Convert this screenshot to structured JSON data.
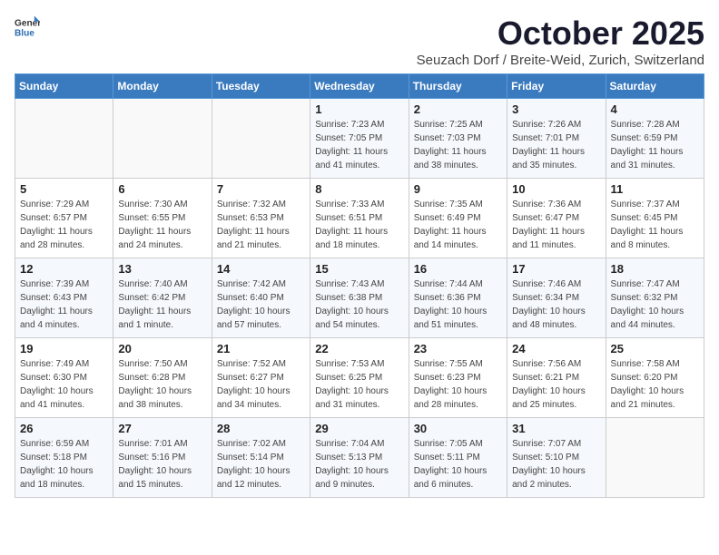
{
  "logo": {
    "text_general": "General",
    "text_blue": "Blue"
  },
  "title": "October 2025",
  "location": "Seuzach Dorf / Breite-Weid, Zurich, Switzerland",
  "days_of_week": [
    "Sunday",
    "Monday",
    "Tuesday",
    "Wednesday",
    "Thursday",
    "Friday",
    "Saturday"
  ],
  "weeks": [
    [
      {
        "day": "",
        "sunrise": "",
        "sunset": "",
        "daylight": ""
      },
      {
        "day": "",
        "sunrise": "",
        "sunset": "",
        "daylight": ""
      },
      {
        "day": "",
        "sunrise": "",
        "sunset": "",
        "daylight": ""
      },
      {
        "day": "1",
        "sunrise": "Sunrise: 7:23 AM",
        "sunset": "Sunset: 7:05 PM",
        "daylight": "Daylight: 11 hours and 41 minutes."
      },
      {
        "day": "2",
        "sunrise": "Sunrise: 7:25 AM",
        "sunset": "Sunset: 7:03 PM",
        "daylight": "Daylight: 11 hours and 38 minutes."
      },
      {
        "day": "3",
        "sunrise": "Sunrise: 7:26 AM",
        "sunset": "Sunset: 7:01 PM",
        "daylight": "Daylight: 11 hours and 35 minutes."
      },
      {
        "day": "4",
        "sunrise": "Sunrise: 7:28 AM",
        "sunset": "Sunset: 6:59 PM",
        "daylight": "Daylight: 11 hours and 31 minutes."
      }
    ],
    [
      {
        "day": "5",
        "sunrise": "Sunrise: 7:29 AM",
        "sunset": "Sunset: 6:57 PM",
        "daylight": "Daylight: 11 hours and 28 minutes."
      },
      {
        "day": "6",
        "sunrise": "Sunrise: 7:30 AM",
        "sunset": "Sunset: 6:55 PM",
        "daylight": "Daylight: 11 hours and 24 minutes."
      },
      {
        "day": "7",
        "sunrise": "Sunrise: 7:32 AM",
        "sunset": "Sunset: 6:53 PM",
        "daylight": "Daylight: 11 hours and 21 minutes."
      },
      {
        "day": "8",
        "sunrise": "Sunrise: 7:33 AM",
        "sunset": "Sunset: 6:51 PM",
        "daylight": "Daylight: 11 hours and 18 minutes."
      },
      {
        "day": "9",
        "sunrise": "Sunrise: 7:35 AM",
        "sunset": "Sunset: 6:49 PM",
        "daylight": "Daylight: 11 hours and 14 minutes."
      },
      {
        "day": "10",
        "sunrise": "Sunrise: 7:36 AM",
        "sunset": "Sunset: 6:47 PM",
        "daylight": "Daylight: 11 hours and 11 minutes."
      },
      {
        "day": "11",
        "sunrise": "Sunrise: 7:37 AM",
        "sunset": "Sunset: 6:45 PM",
        "daylight": "Daylight: 11 hours and 8 minutes."
      }
    ],
    [
      {
        "day": "12",
        "sunrise": "Sunrise: 7:39 AM",
        "sunset": "Sunset: 6:43 PM",
        "daylight": "Daylight: 11 hours and 4 minutes."
      },
      {
        "day": "13",
        "sunrise": "Sunrise: 7:40 AM",
        "sunset": "Sunset: 6:42 PM",
        "daylight": "Daylight: 11 hours and 1 minute."
      },
      {
        "day": "14",
        "sunrise": "Sunrise: 7:42 AM",
        "sunset": "Sunset: 6:40 PM",
        "daylight": "Daylight: 10 hours and 57 minutes."
      },
      {
        "day": "15",
        "sunrise": "Sunrise: 7:43 AM",
        "sunset": "Sunset: 6:38 PM",
        "daylight": "Daylight: 10 hours and 54 minutes."
      },
      {
        "day": "16",
        "sunrise": "Sunrise: 7:44 AM",
        "sunset": "Sunset: 6:36 PM",
        "daylight": "Daylight: 10 hours and 51 minutes."
      },
      {
        "day": "17",
        "sunrise": "Sunrise: 7:46 AM",
        "sunset": "Sunset: 6:34 PM",
        "daylight": "Daylight: 10 hours and 48 minutes."
      },
      {
        "day": "18",
        "sunrise": "Sunrise: 7:47 AM",
        "sunset": "Sunset: 6:32 PM",
        "daylight": "Daylight: 10 hours and 44 minutes."
      }
    ],
    [
      {
        "day": "19",
        "sunrise": "Sunrise: 7:49 AM",
        "sunset": "Sunset: 6:30 PM",
        "daylight": "Daylight: 10 hours and 41 minutes."
      },
      {
        "day": "20",
        "sunrise": "Sunrise: 7:50 AM",
        "sunset": "Sunset: 6:28 PM",
        "daylight": "Daylight: 10 hours and 38 minutes."
      },
      {
        "day": "21",
        "sunrise": "Sunrise: 7:52 AM",
        "sunset": "Sunset: 6:27 PM",
        "daylight": "Daylight: 10 hours and 34 minutes."
      },
      {
        "day": "22",
        "sunrise": "Sunrise: 7:53 AM",
        "sunset": "Sunset: 6:25 PM",
        "daylight": "Daylight: 10 hours and 31 minutes."
      },
      {
        "day": "23",
        "sunrise": "Sunrise: 7:55 AM",
        "sunset": "Sunset: 6:23 PM",
        "daylight": "Daylight: 10 hours and 28 minutes."
      },
      {
        "day": "24",
        "sunrise": "Sunrise: 7:56 AM",
        "sunset": "Sunset: 6:21 PM",
        "daylight": "Daylight: 10 hours and 25 minutes."
      },
      {
        "day": "25",
        "sunrise": "Sunrise: 7:58 AM",
        "sunset": "Sunset: 6:20 PM",
        "daylight": "Daylight: 10 hours and 21 minutes."
      }
    ],
    [
      {
        "day": "26",
        "sunrise": "Sunrise: 6:59 AM",
        "sunset": "Sunset: 5:18 PM",
        "daylight": "Daylight: 10 hours and 18 minutes."
      },
      {
        "day": "27",
        "sunrise": "Sunrise: 7:01 AM",
        "sunset": "Sunset: 5:16 PM",
        "daylight": "Daylight: 10 hours and 15 minutes."
      },
      {
        "day": "28",
        "sunrise": "Sunrise: 7:02 AM",
        "sunset": "Sunset: 5:14 PM",
        "daylight": "Daylight: 10 hours and 12 minutes."
      },
      {
        "day": "29",
        "sunrise": "Sunrise: 7:04 AM",
        "sunset": "Sunset: 5:13 PM",
        "daylight": "Daylight: 10 hours and 9 minutes."
      },
      {
        "day": "30",
        "sunrise": "Sunrise: 7:05 AM",
        "sunset": "Sunset: 5:11 PM",
        "daylight": "Daylight: 10 hours and 6 minutes."
      },
      {
        "day": "31",
        "sunrise": "Sunrise: 7:07 AM",
        "sunset": "Sunset: 5:10 PM",
        "daylight": "Daylight: 10 hours and 2 minutes."
      },
      {
        "day": "",
        "sunrise": "",
        "sunset": "",
        "daylight": ""
      }
    ]
  ]
}
